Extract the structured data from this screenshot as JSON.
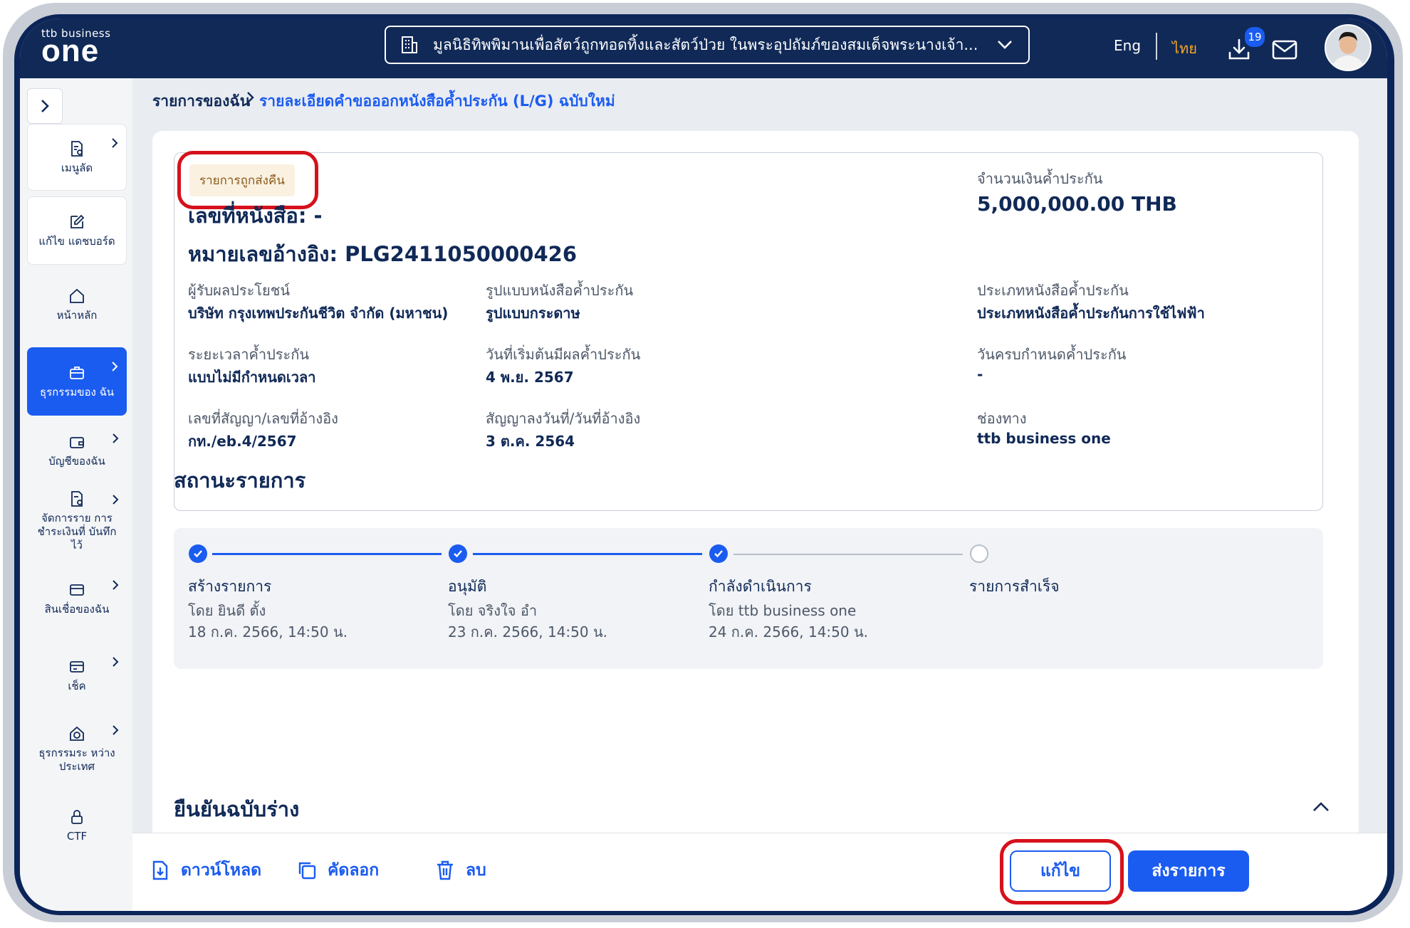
{
  "header": {
    "logo_small": "ttb business",
    "logo_big": "one",
    "org_name": "มูลนิธิทิพพิมานเพื่อสัตว์ถูกทอดทิ้งและสัตว์ป่วย ในพระอุปถัมภ์ของสมเด็จพระนางเจ้า...",
    "lang_en": "Eng",
    "lang_th": "ไทย",
    "download_badge": "19"
  },
  "sidebar": {
    "items": [
      {
        "label": "เมนูลัด",
        "icon": "document-bookmark-icon"
      },
      {
        "label": "แก้ไข แดชบอร์ด",
        "icon": "edit-icon"
      },
      {
        "label": "หน้าหลัก",
        "icon": "home-icon"
      },
      {
        "label": "ธุรกรรมของ ฉัน",
        "icon": "briefcase-icon"
      },
      {
        "label": "บัญชีของฉัน",
        "icon": "wallet-icon"
      },
      {
        "label": "จัดการราย การชำระเงินที่ บันทึกไว้",
        "icon": "document-check-icon"
      },
      {
        "label": "สินเชื่อของฉัน",
        "icon": "credit-card-icon"
      },
      {
        "label": "เช็ค",
        "icon": "cheque-icon"
      },
      {
        "label": "ธุรกรรมระ หว่างประเทศ",
        "icon": "global-house-icon"
      },
      {
        "label": "CTF",
        "icon": "lock-icon"
      }
    ]
  },
  "breadcrumb": {
    "parent": "รายการของฉัน",
    "current": "รายละเอียดคำขอออกหนังสือค้ำประกัน (L/G) ฉบับใหม่"
  },
  "detail": {
    "status_tag": "รายการถูกส่งคืน",
    "doc_no": "เลขที่หนังสือ: -",
    "ref_no": "หมายเลขอ้างอิง: PLG2411050000426",
    "amount_label": "จำนวนเงินค้ำประกัน",
    "amount_value": "5,000,000.00 THB",
    "fields": [
      {
        "label": "ผู้รับผลประโยชน์",
        "value": "บริษัท กรุงเทพประกันชีวิต จำกัด (มหาชน)"
      },
      {
        "label": "รูปแบบหนังสือค้ำประกัน",
        "value": "รูปแบบกระดาษ"
      },
      {
        "label": "ประเภทหนังสือค้ำประกัน",
        "value": "ประเภทหนังสือค้ำประกันการใช้ไฟฟ้า"
      },
      {
        "label": "ระยะเวลาค้ำประกัน",
        "value": "แบบไม่มีกำหนดเวลา"
      },
      {
        "label": "วันที่เริ่มต้นมีผลค้ำประกัน",
        "value": "4 พ.ย. 2567"
      },
      {
        "label": "วันครบกำหนดค้ำประกัน",
        "value": "-"
      },
      {
        "label": "เลขที่สัญญา/เลขที่อ้างอิง",
        "value": "กท./eb.4/2567"
      },
      {
        "label": "สัญญาลงวันที่/วันที่อ้างอิง",
        "value": "3 ต.ค. 2564"
      },
      {
        "label": "ช่องทาง",
        "value": "ttb business one"
      }
    ]
  },
  "status_section": {
    "title": "สถานะรายการ",
    "steps": [
      {
        "title": "สร้างรายการ",
        "by": "โดย ยินดี ตั้ง",
        "time": "18 ก.ค. 2566, 14:50 น.",
        "done": true
      },
      {
        "title": "อนุมัติ",
        "by": "โดย จริงใจ อำ",
        "time": "23 ก.ค. 2566, 14:50 น.",
        "done": true
      },
      {
        "title": "กำลังดำเนินการ",
        "by": "โดย ttb business one",
        "time": "24 ก.ค. 2566, 14:50 น.",
        "done": true
      },
      {
        "title": "รายการสำเร็จ",
        "by": "",
        "time": "",
        "done": false
      }
    ]
  },
  "draft_section": {
    "title": "ยืนยันฉบับร่าง"
  },
  "actions": {
    "download": "ดาวน์โหลด",
    "copy": "คัดลอก",
    "delete": "ลบ",
    "edit": "แก้ไข",
    "submit": "ส่งรายการ"
  },
  "colors": {
    "navy": "#102957",
    "primary": "#1b5cf0",
    "highlight": "#d6111b",
    "status_tag_bg": "#fbf1e1"
  }
}
